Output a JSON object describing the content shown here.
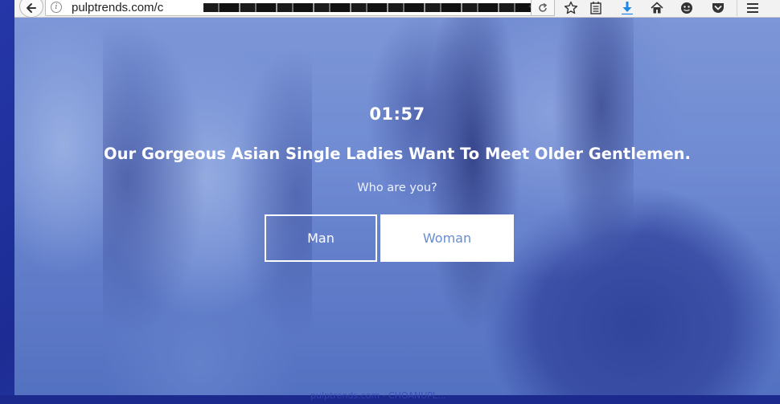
{
  "browser": {
    "url_visible": "pulptrends.com/c",
    "info_icon": "i",
    "toolbar_icons": [
      "back-arrow-icon",
      "info-icon",
      "dropdown-arrow-icon",
      "reload-icon",
      "bookmark-star-icon",
      "reading-list-icon",
      "download-icon",
      "home-icon",
      "emoji-icon",
      "pocket-icon",
      "hamburger-menu-icon"
    ],
    "download_color": "#1f87e8"
  },
  "page": {
    "countdown": "01:57",
    "headline": "Our Gorgeous Asian Single Ladies Want To Meet Older Gentlemen.",
    "question": "Who are you?",
    "btn_man": "Man",
    "btn_woman": "Woman"
  },
  "status_bar": {
    "text": "pulptrends.com - CHOANUPL..."
  },
  "colors": {
    "overlay_blue": "#6f8fd0",
    "button_text_blue": "#6a8ccf",
    "frame_blue": "#1f2f9a"
  }
}
